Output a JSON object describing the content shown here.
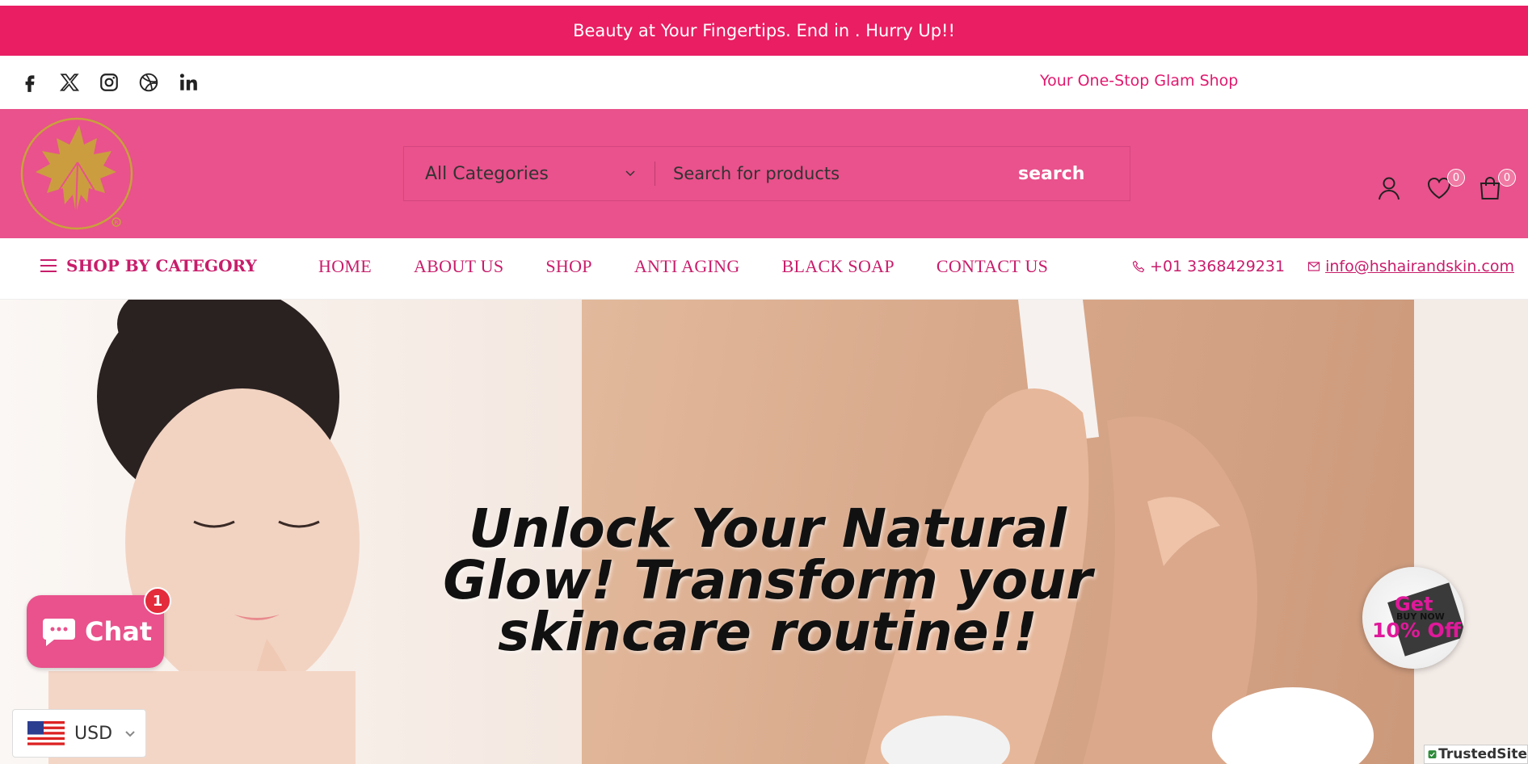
{
  "announcement": {
    "text": "Beauty at Your Fingertips. End in . Hurry Up!!"
  },
  "social": {
    "icons": [
      "facebook-icon",
      "x-twitter-icon",
      "instagram-icon",
      "dribbble-icon",
      "linkedin-icon"
    ],
    "tagline": "Your One-Stop Glam Shop"
  },
  "header": {
    "search": {
      "category": "All Categories",
      "placeholder": "Search for products",
      "button_label": "search"
    },
    "wishlist_count": "0",
    "cart_count": "0"
  },
  "nav": {
    "shop_by_category": "SHOP BY CATEGORY",
    "items": [
      {
        "label": "HOME"
      },
      {
        "label": "ABOUT US"
      },
      {
        "label": "SHOP"
      },
      {
        "label": "ANTI AGING"
      },
      {
        "label": "BLACK SOAP"
      },
      {
        "label": "CONTACT US"
      }
    ],
    "phone": "+01 3368429231",
    "email": "info@hshairandskin.com"
  },
  "hero": {
    "line1": "Unlock Your Natural",
    "line2": "Glow! Transform your",
    "line3": "skincare routine!!"
  },
  "chat": {
    "label": "Chat",
    "badge": "1"
  },
  "currency": {
    "code": "USD"
  },
  "promo": {
    "line1": "Get",
    "line2": "BUY NOW",
    "line3": "10% Off"
  },
  "trusted": {
    "label": "TrustedSite"
  },
  "colors": {
    "brand_pink": "#e91e63",
    "header_pink": "#e9528c",
    "nav_text": "#c81d6b",
    "gold": "#c9a13b"
  }
}
